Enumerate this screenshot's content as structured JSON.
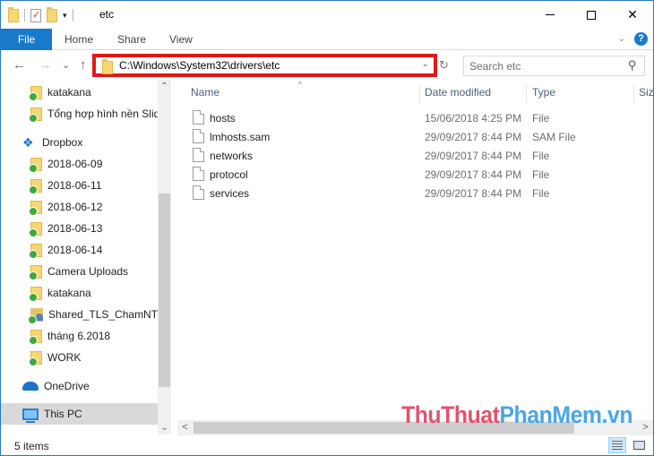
{
  "window": {
    "title": "etc",
    "controls": {
      "minimize": "",
      "maximize": "",
      "close": "✕"
    }
  },
  "quick_access_toolbar": {
    "icons": [
      "folder-icon",
      "properties-icon",
      "new-folder-icon",
      "customize-dropdown-icon"
    ],
    "dropdown_glyph": "▾"
  },
  "ribbon": {
    "tabs": [
      {
        "label": "File",
        "active": true
      },
      {
        "label": "Home"
      },
      {
        "label": "Share"
      },
      {
        "label": "View"
      }
    ],
    "expand_glyph": "⌄",
    "help_glyph": "?"
  },
  "navigation": {
    "back_glyph": "←",
    "forward_glyph": "→",
    "recent_glyph": "⌄",
    "up_glyph": "↑",
    "address": "C:\\Windows\\System32\\drivers\\etc",
    "address_dropdown_glyph": "⌄",
    "refresh_glyph": "↻",
    "search_placeholder": "Search etc",
    "search_glyph": "⚲",
    "highlight_color": "#e01818"
  },
  "nav_pane": {
    "items": [
      {
        "label": "katakana",
        "icon": "synced-folder-icon",
        "level": "sub"
      },
      {
        "label": "Tổng hợp hình nền Slide",
        "icon": "synced-folder-icon",
        "level": "sub"
      },
      {
        "label": "Dropbox",
        "icon": "dropbox-icon",
        "level": "top"
      },
      {
        "label": "2018-06-09",
        "icon": "synced-folder-icon",
        "level": "sub"
      },
      {
        "label": "2018-06-11",
        "icon": "synced-folder-icon",
        "level": "sub"
      },
      {
        "label": "2018-06-12",
        "icon": "synced-folder-icon",
        "level": "sub"
      },
      {
        "label": "2018-06-13",
        "icon": "synced-folder-icon",
        "level": "sub"
      },
      {
        "label": "2018-06-14",
        "icon": "synced-folder-icon",
        "level": "sub"
      },
      {
        "label": "Camera Uploads",
        "icon": "synced-folder-icon",
        "level": "sub"
      },
      {
        "label": "katakana",
        "icon": "synced-folder-icon",
        "level": "sub"
      },
      {
        "label": "Shared_TLS_ChamNT",
        "icon": "shared-folder-icon",
        "level": "sub"
      },
      {
        "label": "tháng 6.2018",
        "icon": "synced-folder-icon",
        "level": "sub"
      },
      {
        "label": "WORK",
        "icon": "synced-folder-icon",
        "level": "sub"
      },
      {
        "label": "OneDrive",
        "icon": "onedrive-icon",
        "level": "top"
      },
      {
        "label": "This PC",
        "icon": "this-pc-icon",
        "level": "top",
        "selected": true
      }
    ],
    "scroll_up_glyph": "⌃",
    "scroll_down_glyph": "⌄"
  },
  "file_list": {
    "sort_glyph": "^",
    "columns": [
      "Name",
      "Date modified",
      "Type",
      "Size"
    ],
    "rows": [
      {
        "name": "hosts",
        "date_modified": "15/06/2018 4:25 PM",
        "type": "File"
      },
      {
        "name": "lmhosts.sam",
        "date_modified": "29/09/2017 8:44 PM",
        "type": "SAM File"
      },
      {
        "name": "networks",
        "date_modified": "29/09/2017 8:44 PM",
        "type": "File"
      },
      {
        "name": "protocol",
        "date_modified": "29/09/2017 8:44 PM",
        "type": "File"
      },
      {
        "name": "services",
        "date_modified": "29/09/2017 8:44 PM",
        "type": "File"
      }
    ],
    "hscroll_left_glyph": "<",
    "hscroll_right_glyph": ">"
  },
  "watermark": {
    "part1": "ThuThuat",
    "part2": "PhanMem.vn"
  },
  "status_bar": {
    "item_count": "5 items"
  }
}
